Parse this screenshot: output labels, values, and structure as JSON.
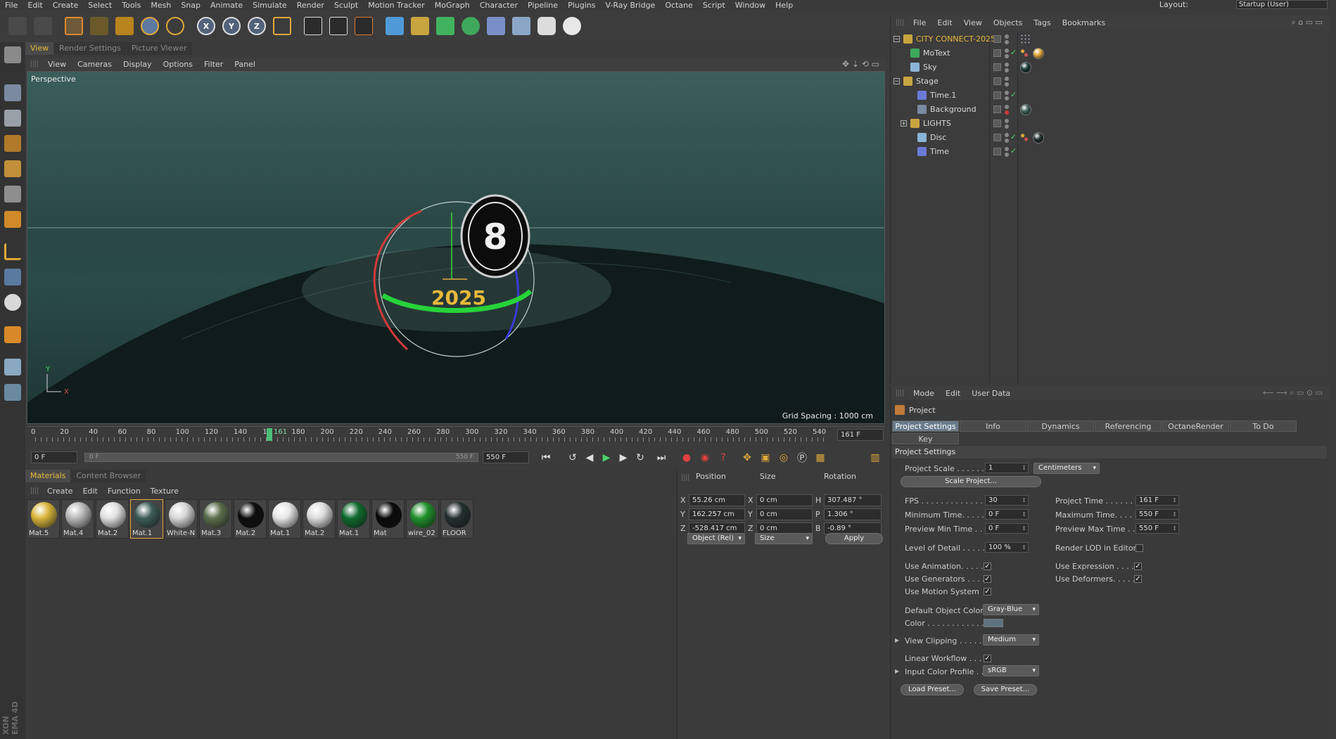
{
  "menubar": [
    "File",
    "Edit",
    "Create",
    "Select",
    "Tools",
    "Mesh",
    "Snap",
    "Animate",
    "Simulate",
    "Render",
    "Sculpt",
    "Motion Tracker",
    "MoGraph",
    "Character",
    "Pipeline",
    "Plugins",
    "V-Ray Bridge",
    "Octane",
    "Script",
    "Window",
    "Help"
  ],
  "layout": {
    "label": "Layout:",
    "value": "Startup (User)"
  },
  "viewport_tabs": [
    "View",
    "Render Settings",
    "Picture Viewer"
  ],
  "viewport_menu": [
    "View",
    "Cameras",
    "Display",
    "Options",
    "Filter",
    "Panel"
  ],
  "viewport": {
    "camera": "Perspective",
    "grid_spacing": "Grid Spacing : 1000 cm",
    "text_2025": "2025",
    "axis_x": "X",
    "axis_y": "Y"
  },
  "timeline": {
    "ticks": [
      "0",
      "20",
      "40",
      "60",
      "80",
      "100",
      "120",
      "140",
      "1",
      "180",
      "200",
      "220",
      "240",
      "260",
      "280",
      "300",
      "320",
      "340",
      "360",
      "380",
      "400",
      "420",
      "440",
      "460",
      "480",
      "500",
      "520",
      "540"
    ],
    "current": "161",
    "current_field": "161 F"
  },
  "transport": {
    "start_field": "0 F",
    "slider_left": "0 F",
    "slider_right": "550 F",
    "end_field": "550 F"
  },
  "materials": {
    "tabs": [
      "Materials",
      "Content Browser"
    ],
    "menu": [
      "Create",
      "Edit",
      "Function",
      "Texture"
    ],
    "items": [
      {
        "name": "Mat.5",
        "color": "#d8b43a"
      },
      {
        "name": "Mat.4",
        "color": "#b9b9b9"
      },
      {
        "name": "Mat.2",
        "color": "#e0e0e0"
      },
      {
        "name": "Mat.1",
        "color": "#3d5c57"
      },
      {
        "name": "White-N",
        "color": "#d6d6d6"
      },
      {
        "name": "Mat.3",
        "color": "#5b6e4c"
      },
      {
        "name": "Mat.2",
        "color": "#0d0d0d"
      },
      {
        "name": "Mat.1",
        "color": "#e6e6e6"
      },
      {
        "name": "Mat.2",
        "color": "#dcdcdc"
      },
      {
        "name": "Mat.1",
        "color": "#0f6a2e"
      },
      {
        "name": "Mat",
        "color": "#0a0a0a"
      },
      {
        "name": "wire_02",
        "color": "#1f8f2a"
      },
      {
        "name": "FLOOR",
        "color": "#23302f"
      }
    ]
  },
  "coordinates": {
    "headers": [
      "Position",
      "Size",
      "Rotation"
    ],
    "rows": [
      {
        "axis": "X",
        "pos": "55.26 cm",
        "size_axis": "X",
        "size": "0 cm",
        "rot_axis": "H",
        "rot": "307.487 °"
      },
      {
        "axis": "Y",
        "pos": "162.257 cm",
        "size_axis": "Y",
        "size": "0 cm",
        "rot_axis": "P",
        "rot": "1.306 °"
      },
      {
        "axis": "Z",
        "pos": "-528.417 cm",
        "size_axis": "Z",
        "size": "0 cm",
        "rot_axis": "B",
        "rot": "-0.89 °"
      }
    ],
    "mode_dd": "Object (Rel)",
    "size_dd": "Size",
    "apply": "Apply"
  },
  "objects": {
    "menu": [
      "File",
      "Edit",
      "View",
      "Objects",
      "Tags",
      "Bookmarks"
    ],
    "items": [
      {
        "name": "CITY CONNECT-2025",
        "indent": 0,
        "color": "#e8b93a"
      },
      {
        "name": "MoText",
        "indent": 1,
        "color": "#d8d8d8"
      },
      {
        "name": "Sky",
        "indent": 1,
        "color": "#d8d8d8"
      },
      {
        "name": "Stage",
        "indent": 0,
        "color": "#d8d8d8"
      },
      {
        "name": "Time.1",
        "indent": 2,
        "color": "#d8d8d8"
      },
      {
        "name": "Background",
        "indent": 2,
        "color": "#d8d8d8"
      },
      {
        "name": "LIGHTS",
        "indent": 1,
        "color": "#d8d8d8"
      },
      {
        "name": "Disc",
        "indent": 2,
        "color": "#d8d8d8"
      },
      {
        "name": "Time",
        "indent": 2,
        "color": "#d8d8d8"
      }
    ]
  },
  "attributes": {
    "menu": [
      "Mode",
      "Edit",
      "User Data"
    ],
    "title": "Project",
    "tabs": [
      "Project Settings",
      "Info",
      "Dynamics",
      "Referencing",
      "OctaneRender",
      "To Do"
    ],
    "tab2": "Key Interpolation",
    "section": "Project Settings",
    "project_scale_label": "Project Scale . . . . . .",
    "project_scale_value": "1",
    "project_scale_unit": "Centimeters",
    "scale_project_btn": "Scale Project...",
    "fps_label": "FPS . . . . . . . . . . . . .",
    "fps_value": "30",
    "project_time_label": "Project Time . . . . . . .",
    "project_time_value": "161 F",
    "min_time_label": "Minimum Time. . . . . .",
    "min_time_value": "0 F",
    "max_time_label": "Maximum Time. . . . . .",
    "max_time_value": "550 F",
    "prev_min_label": "Preview Min Time . . .",
    "prev_min_value": "0 F",
    "prev_max_label": "Preview Max Time . . .",
    "prev_max_value": "550 F",
    "lod_label": "Level of Detail . . . . .",
    "lod_value": "100 %",
    "render_lod_label": "Render LOD in Editor",
    "use_anim_label": "Use Animation. . . . .",
    "use_expr_label": "Use Expression . . . . .",
    "use_gen_label": "Use Generators . . . .",
    "use_def_label": "Use Deformers. . . . . .",
    "use_motion_label": "Use Motion System",
    "def_color_label": "Default Object Color",
    "def_color_value": "Gray-Blue",
    "color_label": "Color . . . . . . . . . . . .",
    "view_clip_label": "View Clipping . . . . .",
    "view_clip_value": "Medium",
    "linear_label": "Linear Workflow . . . .",
    "icp_label": "Input Color Profile . .",
    "icp_value": "sRGB",
    "load_preset": "Load Preset...",
    "save_preset": "Save Preset..."
  },
  "brand": "XON EMA 4D"
}
